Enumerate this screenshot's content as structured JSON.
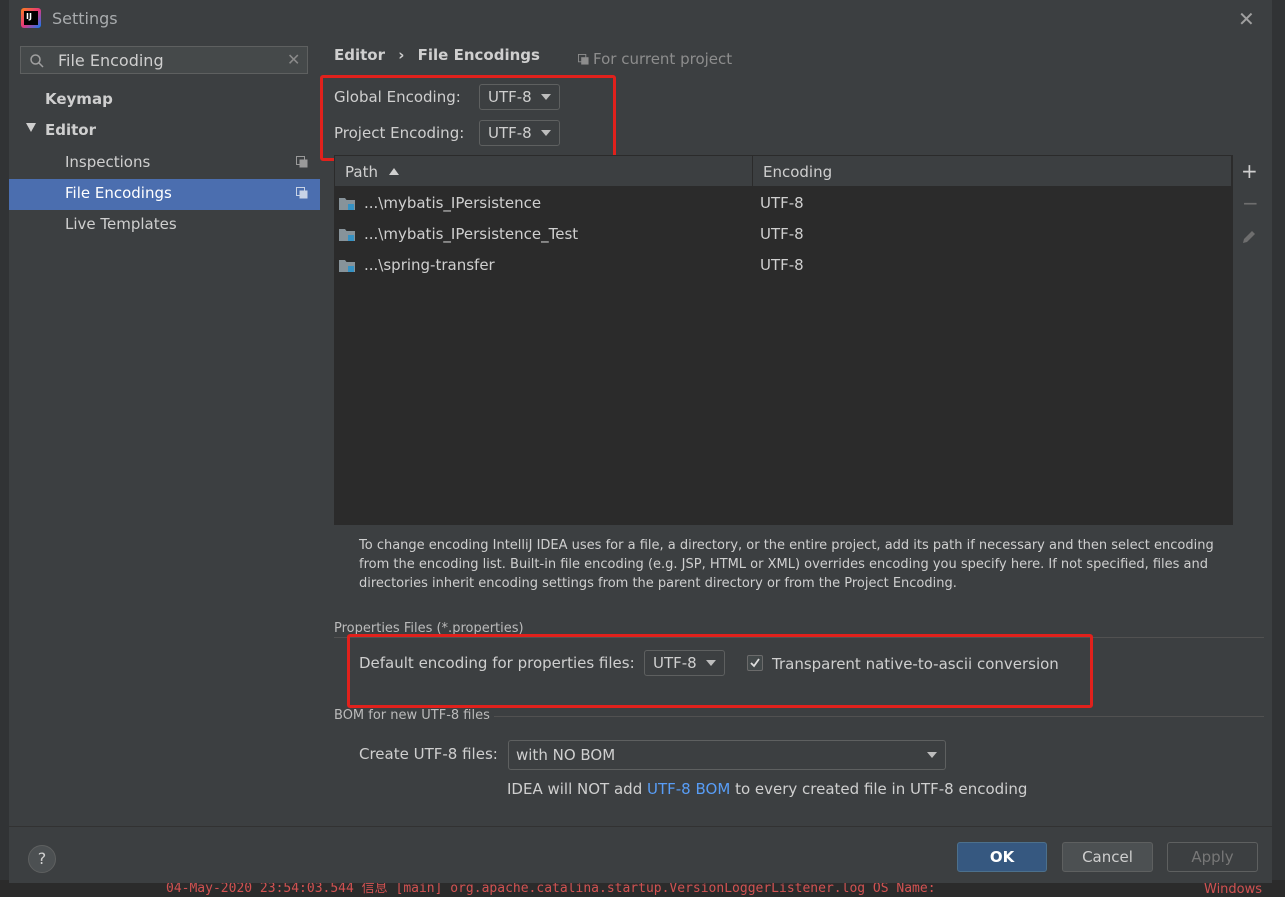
{
  "window": {
    "title": "Settings"
  },
  "search": {
    "value": "File Encoding"
  },
  "sidebar": {
    "items": [
      {
        "label": "Keymap"
      },
      {
        "label": "Editor"
      },
      {
        "label": "Inspections"
      },
      {
        "label": "File Encodings"
      },
      {
        "label": "Live Templates"
      }
    ]
  },
  "header": {
    "breadcrumb_root": "Editor",
    "breadcrumb_sep": "›",
    "breadcrumb_current": "File Encodings",
    "scope": "For current project"
  },
  "encodings": {
    "global_label": "Global Encoding:",
    "global_value": "UTF-8",
    "project_label": "Project Encoding:",
    "project_value": "UTF-8"
  },
  "table": {
    "columns": [
      "Path",
      "Encoding"
    ],
    "rows": [
      {
        "path": "...\\mybatis_IPersistence",
        "encoding": "UTF-8"
      },
      {
        "path": "...\\mybatis_IPersistence_Test",
        "encoding": "UTF-8"
      },
      {
        "path": "...\\spring-transfer",
        "encoding": "UTF-8"
      }
    ]
  },
  "info_text": "To change encoding IntelliJ IDEA uses for a file, a directory, or the entire project, add its path if necessary and then select encoding from the encoding list. Built-in file encoding (e.g. JSP, HTML or XML) overrides encoding you specify here. If not specified, files and directories inherit encoding settings from the parent directory or from the Project Encoding.",
  "properties": {
    "section_title": "Properties Files (*.properties)",
    "default_label": "Default encoding for properties files:",
    "default_value": "UTF-8",
    "native_label": "Transparent native-to-ascii conversion",
    "native_checked": true
  },
  "bom": {
    "section_title": "BOM for new UTF-8 files",
    "create_label": "Create UTF-8 files:",
    "create_value": "with NO BOM",
    "note_prefix": "IDEA will NOT add",
    "note_link": "UTF-8 BOM",
    "note_suffix": "to every created file in UTF-8 encoding"
  },
  "footer": {
    "help": "?",
    "ok": "OK",
    "cancel": "Cancel",
    "apply": "Apply"
  },
  "background": {
    "console_line": "04-May-2020 23:54:03.544 信息 [main] org.apache.catalina.startup.VersionLoggerListener.log OS Name:",
    "console_right": "Windows"
  },
  "colors": {
    "dialog_bg": "#3c3f41",
    "selection": "#4b6eaf",
    "highlight_box": "#e1211c",
    "link": "#589df6",
    "ok_button": "#365880"
  }
}
